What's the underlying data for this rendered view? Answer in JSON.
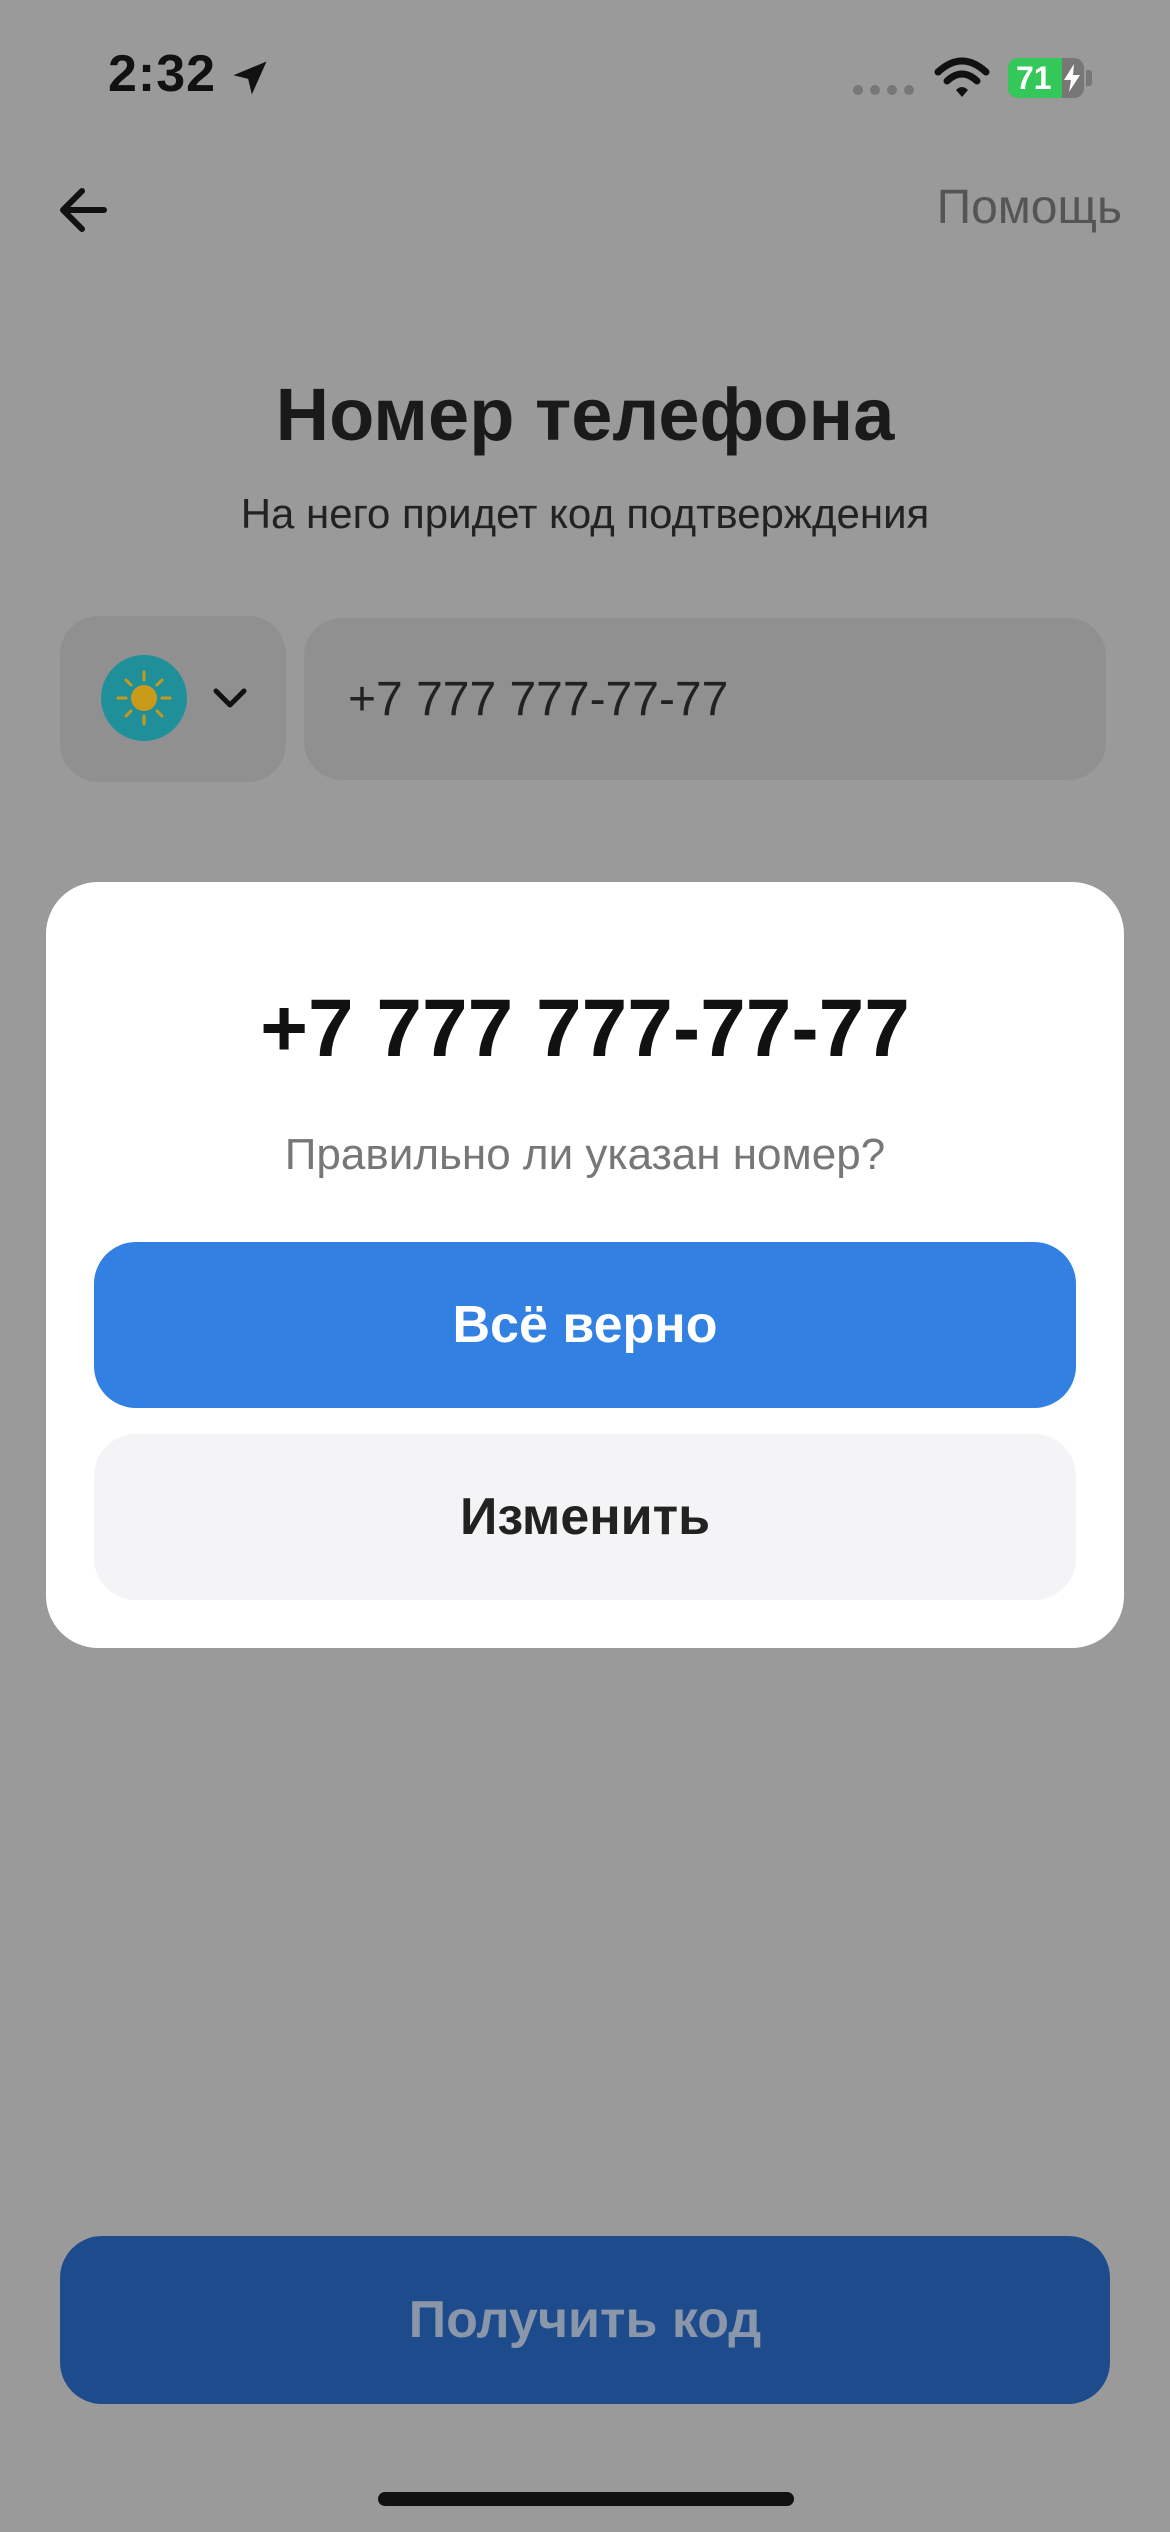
{
  "status_bar": {
    "time": "2:32",
    "battery_text": "71",
    "battery_level": 0.71,
    "location_icon": "location-arrow-icon",
    "wifi_icon": "wifi-icon"
  },
  "header": {
    "back_icon": "arrow-left-icon",
    "help_label": "Помощь"
  },
  "main": {
    "title": "Номер телефона",
    "subtitle": "На него придет код подтверждения",
    "country_icon": "kazakhstan-flag-icon",
    "phone_value": "+7 777 777-77-77",
    "cta_label": "Получить код"
  },
  "modal": {
    "phone": "+7 777 777-77-77",
    "question": "Правильно ли указан номер?",
    "confirm_label": "Всё верно",
    "change_label": "Изменить"
  },
  "colors": {
    "accent": "#3180e2",
    "overlay": "#9a9a9a",
    "cta_dimmed": "#1d4b8c"
  }
}
